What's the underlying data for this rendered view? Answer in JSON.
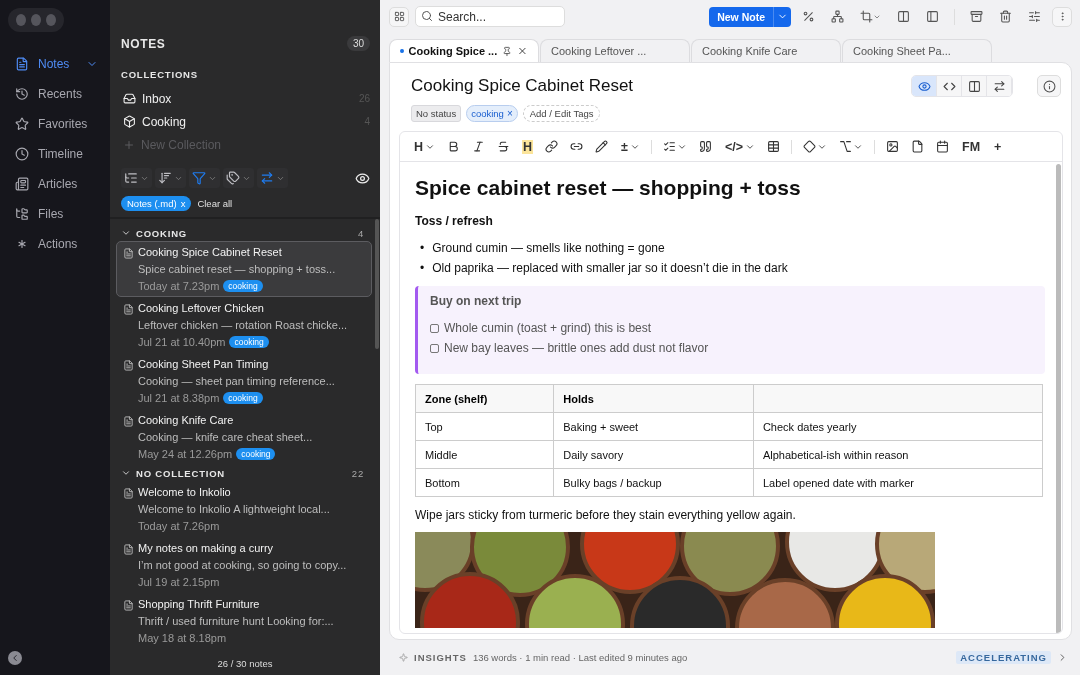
{
  "nav": {
    "items": [
      {
        "label": "Notes",
        "selected": true,
        "expanded": true
      },
      {
        "label": "Recents",
        "selected": false,
        "expanded": false
      },
      {
        "label": "Favorites",
        "selected": false,
        "expanded": false
      },
      {
        "label": "Timeline",
        "selected": false,
        "expanded": false
      },
      {
        "label": "Articles",
        "selected": false,
        "expanded": false
      },
      {
        "label": "Files",
        "selected": false,
        "expanded": false
      },
      {
        "label": "Actions",
        "selected": false,
        "expanded": false
      }
    ]
  },
  "notes_panel": {
    "title": "NOTES",
    "count": "30",
    "collections_heading": "COLLECTIONS",
    "collections": [
      {
        "label": "Inbox",
        "count": "26"
      },
      {
        "label": "Cooking",
        "count": "4"
      }
    ],
    "new_collection": "New Collection",
    "filters": [
      {
        "active": false
      },
      {
        "active": false
      },
      {
        "active": true
      },
      {
        "active": false
      },
      {
        "active": true
      }
    ],
    "chips": [
      {
        "label": "Notes (.md)",
        "remove": "x"
      }
    ],
    "clear_all": "Clear all",
    "groups": [
      {
        "title": "COOKING",
        "count": "4",
        "expanded": true,
        "notes": [
          {
            "title": "Cooking Spice Cabinet Reset",
            "snippet": "Spice cabinet reset — shopping + toss...",
            "date": "Today at 7.23pm",
            "tag": "cooking",
            "selected": true
          },
          {
            "title": "Cooking Leftover Chicken",
            "snippet": "Leftover chicken — rotation Roast chicke...",
            "date": "Jul 21 at 10.40pm",
            "tag": "cooking",
            "selected": false
          },
          {
            "title": "Cooking Sheet Pan Timing",
            "snippet": "Cooking — sheet pan timing reference...",
            "date": "Jul 21 at 8.38pm",
            "tag": "cooking",
            "selected": false
          },
          {
            "title": "Cooking Knife Care",
            "snippet": "Cooking — knife care cheat sheet...",
            "date": "May 24 at 12.26pm",
            "tag": "cooking",
            "selected": false
          }
        ]
      },
      {
        "title": "NO COLLECTION",
        "count": "22",
        "expanded": true,
        "notes": [
          {
            "title": "Welcome to Inkolio",
            "snippet": "Welcome to Inkolio A lightweight local...",
            "date": "Today at 7.26pm",
            "selected": false
          },
          {
            "title": "My notes on making a curry",
            "snippet": "I’m not good at cooking, so going to copy...",
            "date": "Jul 19 at 2.15pm",
            "selected": false
          },
          {
            "title": "Shopping Thrift Furniture",
            "snippet": "Thrift / used furniture hunt Looking for:...",
            "date": "May 18 at 8.18pm",
            "selected": false
          }
        ]
      }
    ],
    "footer": "26 / 30 notes"
  },
  "toolbar": {
    "search_placeholder": "Search...",
    "new_note": "New Note"
  },
  "tabs": [
    {
      "label": "Cooking Spice ...",
      "selected": true
    },
    {
      "label": "Cooking Leftover ...",
      "selected": false
    },
    {
      "label": "Cooking Knife Care",
      "selected": false
    },
    {
      "label": "Cooking Sheet Pa...",
      "selected": false
    }
  ],
  "note": {
    "title": "Cooking Spice Cabinet Reset",
    "status": "No status",
    "tags": [
      {
        "label": "cooking",
        "remove": "×"
      }
    ],
    "add_tags": "Add / Edit Tags",
    "view_modes": [
      {
        "selected": true
      },
      {
        "selected": false
      },
      {
        "selected": false
      },
      {
        "selected": false
      }
    ]
  },
  "format_toolbar": [
    {
      "kind": "text",
      "label": "H",
      "dropdown": true,
      "highlight": false
    },
    {
      "kind": "icon",
      "dropdown": false
    },
    {
      "kind": "icon",
      "dropdown": false
    },
    {
      "kind": "icon",
      "dropdown": false
    },
    {
      "kind": "text",
      "label": "H",
      "dropdown": false,
      "highlight": true
    },
    {
      "kind": "icon",
      "dropdown": false
    },
    {
      "kind": "icon",
      "dropdown": false
    },
    {
      "kind": "icon",
      "dropdown": false
    },
    {
      "kind": "text",
      "label": "±",
      "dropdown": true,
      "highlight": false
    },
    {
      "kind": "divider"
    },
    {
      "kind": "icon",
      "dropdown": true
    },
    {
      "kind": "icon",
      "dropdown": false
    },
    {
      "kind": "text",
      "label": "</>",
      "dropdown": true,
      "highlight": false
    },
    {
      "kind": "icon",
      "dropdown": false
    },
    {
      "kind": "divider"
    },
    {
      "kind": "icon",
      "dropdown": true
    },
    {
      "kind": "icon",
      "dropdown": true
    },
    {
      "kind": "divider"
    },
    {
      "kind": "icon",
      "dropdown": false
    },
    {
      "kind": "icon",
      "dropdown": false
    },
    {
      "kind": "icon",
      "dropdown": false
    },
    {
      "kind": "text",
      "label": "FM",
      "dropdown": false,
      "highlight": false
    },
    {
      "kind": "text",
      "label": "+",
      "dropdown": false,
      "highlight": false
    }
  ],
  "document": {
    "heading": "Spice cabinet reset — shopping + toss",
    "subheading": "Toss / refresh",
    "bullets": [
      {
        "marker": "•",
        "text": "Ground cumin — smells like nothing = gone"
      },
      {
        "marker": "•",
        "text": "Old paprika — replaced with smaller jar so it doesn’t die in the dark"
      }
    ],
    "callout": {
      "title": "Buy on next trip",
      "tasks": [
        {
          "label": "Whole cumin (toast + grind) this is best",
          "checked": false
        },
        {
          "label": "New bay leaves — brittle ones add dust not flavor",
          "checked": false
        }
      ]
    },
    "table": {
      "columns": [
        "Zone (shelf)",
        "Holds"
      ],
      "rows": [
        [
          "Top",
          "Baking + sweet",
          "Check dates yearly"
        ],
        [
          "Middle",
          "Daily savory",
          "Alphabetical-ish within reason"
        ],
        [
          "Bottom",
          "Bulky bags / backup",
          "Label opened date with marker"
        ]
      ]
    },
    "paragraph": "Wipe jars sticky from turmeric before they stain everything yellow again."
  },
  "status_bar": {
    "label": "INSIGHTS",
    "stats": "136 words · 1 min read · Last edited 9 minutes ago",
    "badge": "ACCELERATING"
  }
}
